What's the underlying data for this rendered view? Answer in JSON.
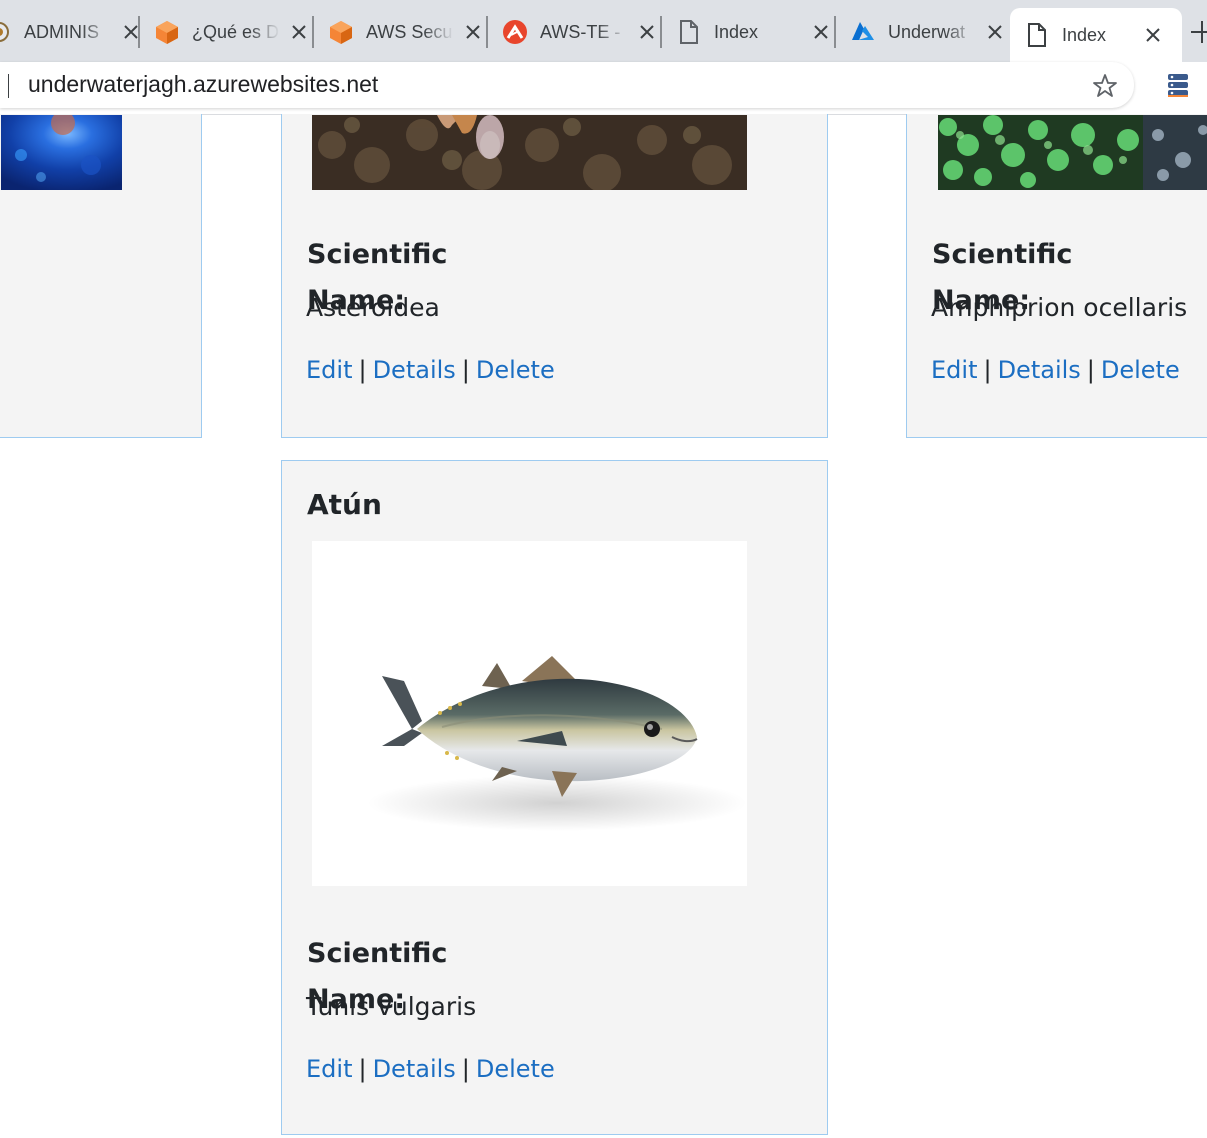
{
  "browser": {
    "tabs": [
      {
        "title": "ADMINIS",
        "icon": "chrome-extension-icon",
        "active": false
      },
      {
        "title": "¿Qué es D",
        "icon": "aws-cube-icon",
        "active": false
      },
      {
        "title": "AWS Secu",
        "icon": "aws-cube-icon",
        "active": false
      },
      {
        "title": "AWS-TE -",
        "icon": "red-logo-icon",
        "active": false
      },
      {
        "title": "Index",
        "icon": "page-icon",
        "active": false
      },
      {
        "title": "Underwat",
        "icon": "azure-icon",
        "active": false
      },
      {
        "title": "Index",
        "icon": "page-icon",
        "active": true
      }
    ],
    "url": "underwaterjagh.azurewebsites.net"
  },
  "cards": {
    "left": {
      "image": "blue-coral-image"
    },
    "middle_top": {
      "image": "starfish-reef-image",
      "sci_label": "Scientific Name:",
      "sci_value": "Asteroidea",
      "edit": "Edit",
      "details": "Details",
      "delete": "Delete"
    },
    "right_top": {
      "image": "green-anemone-image",
      "sci_label": "Scientific Name:",
      "sci_value": "Amphiprion ocellaris",
      "edit": "Edit",
      "details": "Details",
      "delete": "Delete"
    },
    "atun": {
      "title": "Atún",
      "image": "tuna-fish-image",
      "sci_label": "Scientific Name:",
      "sci_value": "Tunis vulgaris",
      "edit": "Edit",
      "details": "Details",
      "delete": "Delete"
    }
  },
  "colors": {
    "link": "#1b6ec2",
    "card_border": "#9ecbf0",
    "card_bg": "#f4f4f4"
  }
}
